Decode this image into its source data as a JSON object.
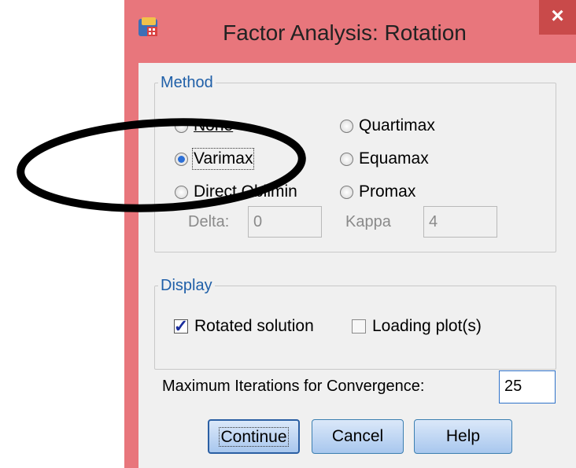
{
  "window": {
    "title": "Factor Analysis: Rotation",
    "close_symbol": "×",
    "app_icon": "spss-app-icon"
  },
  "method": {
    "title": "Method",
    "options": [
      {
        "label": "None",
        "checked": false
      },
      {
        "label": "Quartimax",
        "checked": false
      },
      {
        "label": "Varimax",
        "checked": true
      },
      {
        "label": "Equamax",
        "checked": false
      },
      {
        "label": "Direct Oblimin",
        "checked": false
      },
      {
        "label": "Promax",
        "checked": false
      }
    ],
    "delta_label": "Delta:",
    "delta_value": "0",
    "kappa_label": "Kappa",
    "kappa_value": "4"
  },
  "display": {
    "title": "Display",
    "rotated_solution": {
      "label": "Rotated solution",
      "checked": true
    },
    "loading_plots": {
      "label": "Loading plot(s)",
      "checked": false
    }
  },
  "iterations": {
    "label": "Maximum Iterations for Convergence:",
    "value": "25"
  },
  "buttons": {
    "continue": "Continue",
    "cancel": "Cancel",
    "help": "Help"
  },
  "colors": {
    "title_bar": "#e8767c",
    "close_button": "#c94a4a",
    "group_title": "#1f5fa8",
    "button_border": "#3c7fb1"
  }
}
